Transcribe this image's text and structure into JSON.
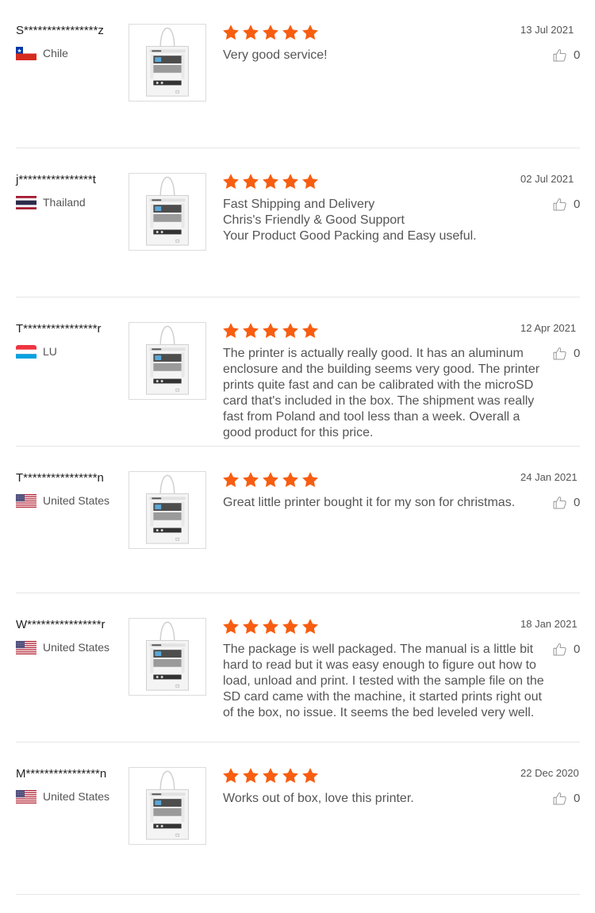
{
  "colors": {
    "star": "#f85d10",
    "divider": "#e6e6e6",
    "text": "#555555"
  },
  "reviews": [
    {
      "user": "S****************z",
      "country": "Chile",
      "flag": "chile-flag",
      "rating": 5,
      "date": "13 Jul 2021",
      "likes": "0",
      "text": "Very good service!"
    },
    {
      "user": "j****************t",
      "country": "Thailand",
      "flag": "thailand-flag",
      "rating": 5,
      "date": "02 Jul 2021",
      "likes": "0",
      "text": "Fast Shipping and Delivery\nChris's Friendly & Good Support\nYour Product Good Packing and Easy useful."
    },
    {
      "user": "T****************r",
      "country": "LU",
      "flag": "luxembourg-flag",
      "rating": 5,
      "date": "12 Apr 2021",
      "likes": "0",
      "text": "The printer is actually really good. It has an aluminum enclosure and the building seems very good. The printer prints quite fast and can be calibrated with the microSD card that's included in the box. The shipment was really fast from Poland and tool less than a week. Overall a good product for this price."
    },
    {
      "user": "T****************n",
      "country": "United States",
      "flag": "us-flag",
      "rating": 5,
      "date": "24 Jan 2021",
      "likes": "0",
      "text": "Great little printer bought it for my son for christmas."
    },
    {
      "user": "W****************r",
      "country": "United States",
      "flag": "us-flag",
      "rating": 5,
      "date": "18 Jan 2021",
      "likes": "0",
      "text": "The package is well packaged. The manual is a little bit hard to read but it was easy enough to figure out how to load, unload and print. I tested with the sample file on the SD card came with the machine, it started prints right out of the box, no issue. It seems the bed leveled very well."
    },
    {
      "user": "M****************n",
      "country": "United States",
      "flag": "us-flag",
      "rating": 5,
      "date": "22 Dec 2020",
      "likes": "0",
      "text": "Works out of box, love this printer."
    }
  ]
}
